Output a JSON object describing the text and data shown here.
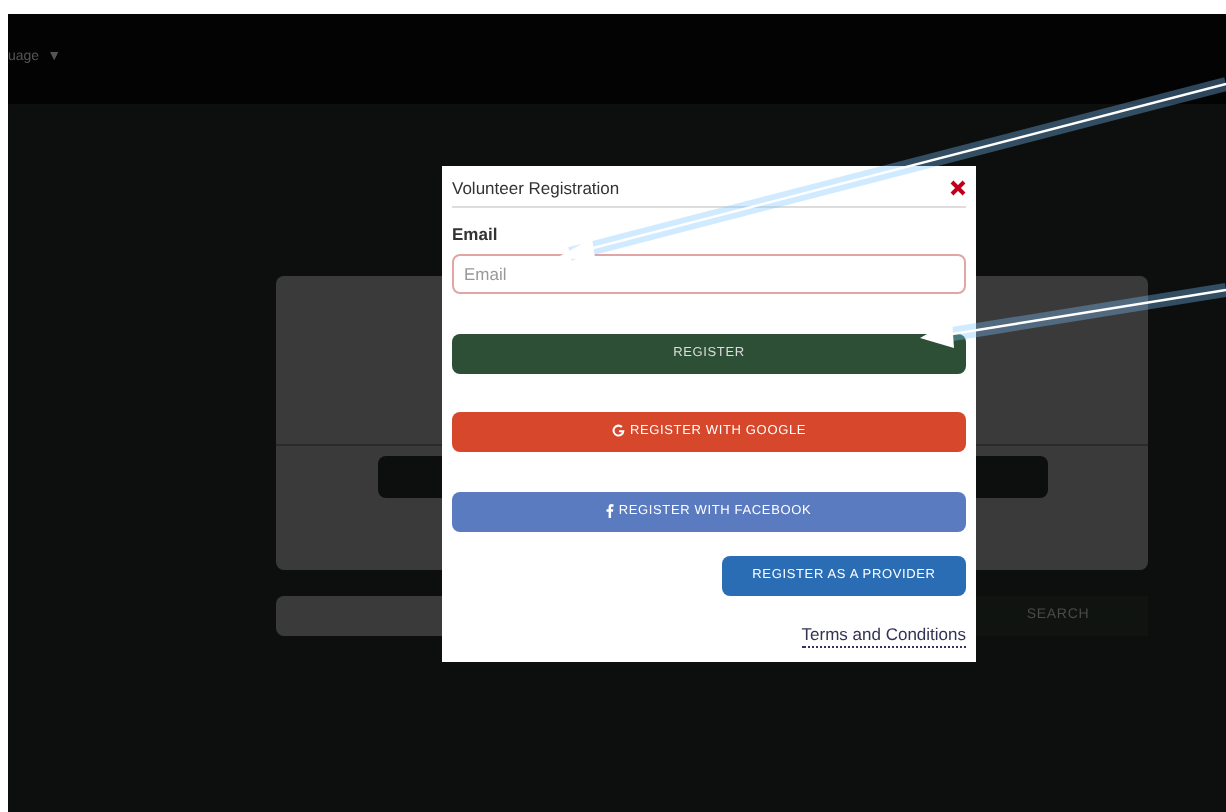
{
  "top_bar": {
    "language_label": "uage",
    "language_caret": "▼"
  },
  "background": {
    "search_button": "SEARCH"
  },
  "modal": {
    "title": "Volunteer Registration",
    "email": {
      "label": "Email",
      "placeholder": "Email"
    },
    "buttons": [
      {
        "kind": "register",
        "label": "REGISTER"
      },
      {
        "kind": "google",
        "label": "REGISTER WITH GOOGLE"
      },
      {
        "kind": "facebook",
        "label": "REGISTER WITH FACEBOOK"
      },
      {
        "kind": "provider",
        "label": "REGISTER AS A PROVIDER"
      }
    ],
    "terms_link": "Terms and Conditions"
  }
}
